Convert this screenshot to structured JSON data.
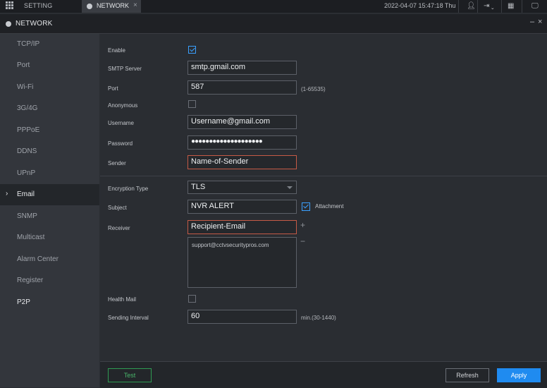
{
  "topbar": {
    "setting_label": "SETTING",
    "tab_label": "NETWORK",
    "tab_close": "×",
    "datetime": "2022-04-07 15:47:18 Thu",
    "icons": [
      "grid-menu-icon",
      "network-icon",
      "user-icon",
      "logout-icon",
      "qr-icon",
      "monitor-icon"
    ]
  },
  "titlebar": {
    "title": "NETWORK",
    "minimize": "–",
    "close": "×"
  },
  "sidebar": {
    "items": [
      {
        "label": "TCP/IP"
      },
      {
        "label": "Port"
      },
      {
        "label": "Wi-Fi"
      },
      {
        "label": "3G/4G"
      },
      {
        "label": "PPPoE"
      },
      {
        "label": "DDNS"
      },
      {
        "label": "UPnP"
      },
      {
        "label": "Email"
      },
      {
        "label": "SNMP"
      },
      {
        "label": "Multicast"
      },
      {
        "label": "Alarm Center"
      },
      {
        "label": "Register"
      },
      {
        "label": "P2P"
      }
    ],
    "active_item": "Email",
    "arrow": "›"
  },
  "form": {
    "enable": {
      "label": "Enable",
      "checked": true
    },
    "smtp_server": {
      "label": "SMTP Server",
      "value": "smtp.gmail.com"
    },
    "port": {
      "label": "Port",
      "value": "587",
      "hint": "(1-65535)"
    },
    "anonymous": {
      "label": "Anonymous",
      "checked": false
    },
    "username": {
      "label": "Username",
      "value": "Username@gmail.com"
    },
    "password": {
      "label": "Password",
      "value": "●●●●●●●●●●●●●●●●●●●●"
    },
    "sender": {
      "label": "Sender",
      "value": "Name-of-Sender"
    },
    "encryption_type": {
      "label": "Encryption Type",
      "value": "TLS"
    },
    "subject": {
      "label": "Subject",
      "value": "NVR ALERT"
    },
    "attachment": {
      "label": "Attachment",
      "checked": true
    },
    "receiver": {
      "label": "Receiver",
      "value": "Recipient-Email",
      "add": "+",
      "remove": "−"
    },
    "receiver_list": [
      "support@cctvsecuritypros.com"
    ],
    "health_mail": {
      "label": "Health Mail",
      "checked": false
    },
    "sending_interval": {
      "label": "Sending Interval",
      "value": "60",
      "hint": "min.(30-1440)"
    }
  },
  "buttons": {
    "test": "Test",
    "refresh": "Refresh",
    "apply": "Apply"
  },
  "colors": {
    "accent": "#1f8bf0",
    "test_green": "#49b56a",
    "error_border": "#c55a46"
  }
}
